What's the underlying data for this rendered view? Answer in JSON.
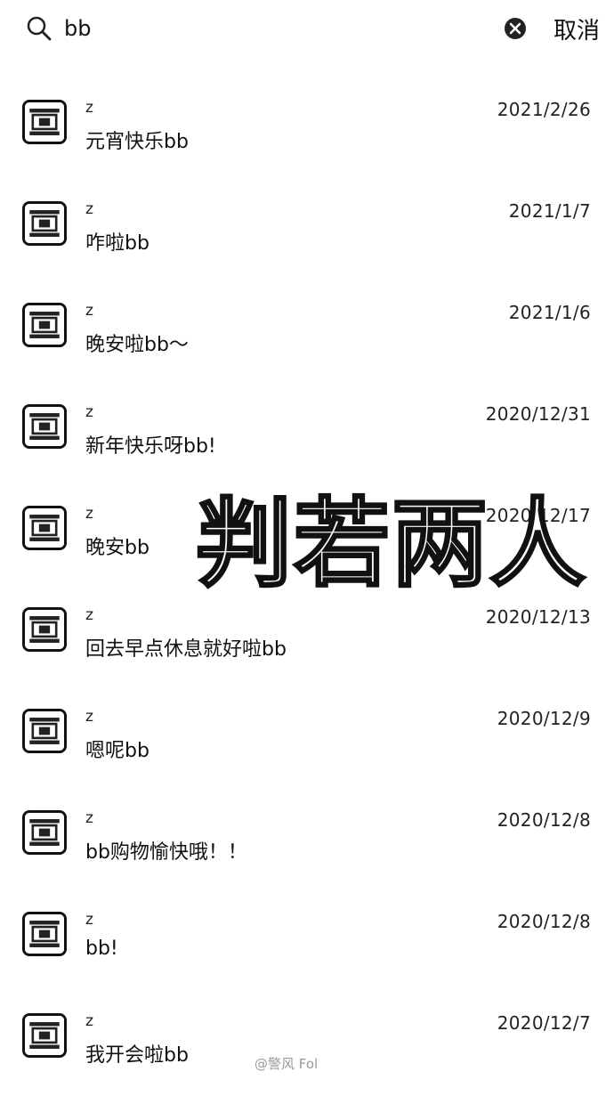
{
  "search": {
    "query": "bb",
    "cancel_label": "取消"
  },
  "results": [
    {
      "sender": "z",
      "date": "2021/2/26",
      "message": "元宵快乐bb"
    },
    {
      "sender": "z",
      "date": "2021/1/7",
      "message": "咋啦bb"
    },
    {
      "sender": "z",
      "date": "2021/1/6",
      "message": "晚安啦bb～"
    },
    {
      "sender": "z",
      "date": "2020/12/31",
      "message": "新年快乐呀bb!"
    },
    {
      "sender": "z",
      "date": "2020/12/17",
      "message": "晚安bb"
    },
    {
      "sender": "z",
      "date": "2020/12/13",
      "message": "回去早点休息就好啦bb"
    },
    {
      "sender": "z",
      "date": "2020/12/9",
      "message": "嗯呢bb"
    },
    {
      "sender": "z",
      "date": "2020/12/8",
      "message": "bb购物愉快哦！！"
    },
    {
      "sender": "z",
      "date": "2020/12/8",
      "message": "bb!"
    },
    {
      "sender": "z",
      "date": "2020/12/7",
      "message": "我开会啦bb"
    }
  ],
  "overlay_title": "判若两人",
  "watermark": "@警风 Fol",
  "icons": {
    "search": "search-icon",
    "clear": "clear-icon",
    "avatar": "avatar-image"
  }
}
